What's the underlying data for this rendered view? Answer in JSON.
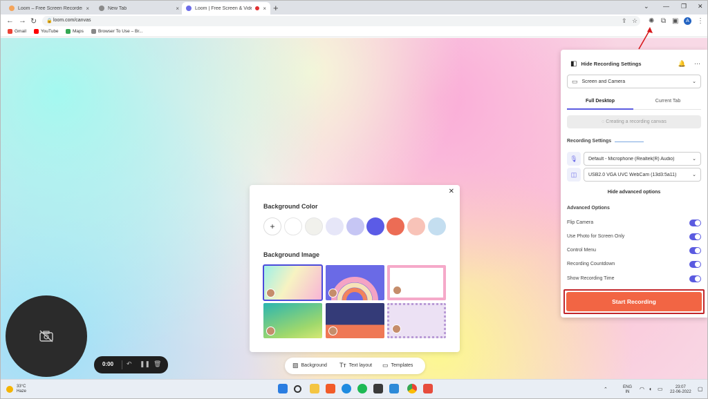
{
  "browser": {
    "tabs": [
      {
        "title": "Loom – Free Screen Recorder &",
        "close": "×",
        "active": false
      },
      {
        "title": "New Tab",
        "close": "×",
        "active": false
      },
      {
        "title": "Loom | Free Screen & Video",
        "close": "×",
        "active": true
      }
    ],
    "new_tab": "+",
    "url": "loom.com/canvas",
    "bookmarks": [
      {
        "label": "Gmail",
        "color": "#ea4335"
      },
      {
        "label": "YouTube",
        "color": "#ff0000"
      },
      {
        "label": "Maps",
        "color": "#34a853"
      },
      {
        "label": "Browser To Use – Br...",
        "color": "#888888"
      }
    ],
    "profile_initial": "A"
  },
  "panel": {
    "title": "Hide Recording Settings",
    "mode": "Screen and Camera",
    "tabs": [
      "Full Desktop",
      "Current Tab"
    ],
    "canvas_status": "Creating a recording canvas",
    "recording_settings_label": "Recording Settings",
    "microphone": "Default - Microphone (Realtek(R) Audio)",
    "camera": "USB2.0 VGA UVC WebCam (13d3:5a11)",
    "hide_advanced": "Hide advanced options",
    "advanced_label": "Advanced Options",
    "options": [
      {
        "label": "Flip Camera",
        "on": true
      },
      {
        "label": "Use Photo for Screen Only",
        "on": true
      },
      {
        "label": "Control Menu",
        "on": true
      },
      {
        "label": "Recording Countdown",
        "on": true
      },
      {
        "label": "Show Recording Time",
        "on": true
      }
    ],
    "start_label": "Start Recording",
    "accent": "#5b5be0",
    "start_color": "#f26544"
  },
  "background_card": {
    "color_heading": "Background Color",
    "add_label": "+",
    "colors": [
      "#ffffff",
      "#f1f1ec",
      "#e6e6f8",
      "#c6c6f4",
      "#5b5be6",
      "#ec6c55",
      "#f8c3b8",
      "#c4def0"
    ],
    "image_heading": "Background Image"
  },
  "bottom_tools": {
    "background": "Background",
    "text_layout": "Text layout",
    "templates": "Templates"
  },
  "control": {
    "time": "0:00"
  },
  "taskbar": {
    "temp": "33°C",
    "condition": "Haze",
    "lang": "ENG",
    "region": "IN",
    "time": "23:07",
    "date": "22-06-2022"
  }
}
